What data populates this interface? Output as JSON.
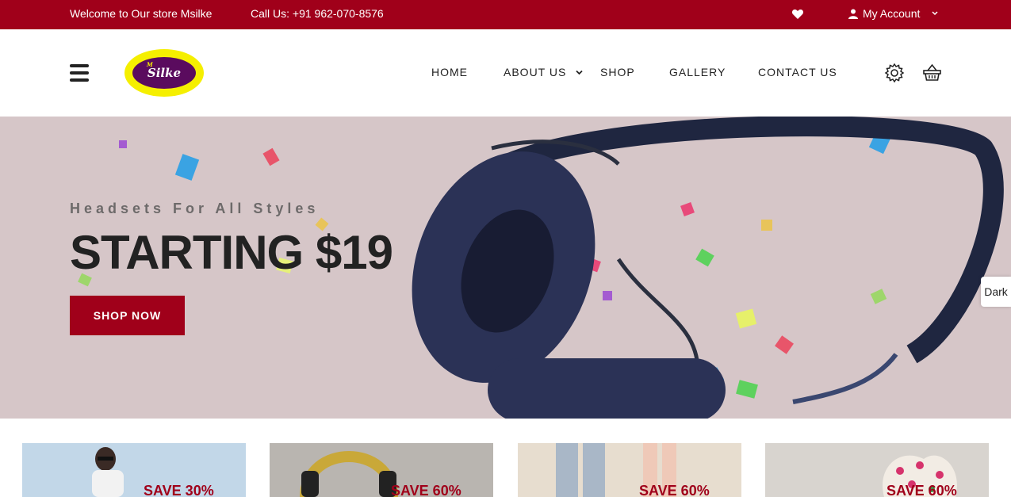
{
  "topbar": {
    "welcome": "Welcome to Our store Msilke",
    "phone": "Call Us: +91 962-070-8576",
    "account": "My Account"
  },
  "header": {
    "logo_small": "M",
    "logo_text": "Silke",
    "nav": [
      "HOME",
      "ABOUT US",
      "SHOP",
      "GALLERY",
      "CONTACT US"
    ]
  },
  "hero": {
    "tagline": "Headsets For All Styles",
    "title": "STARTING $19",
    "button": "SHOP NOW"
  },
  "dark_toggle": "Dark",
  "promos": [
    "SAVE 30%",
    "SAVE 60%",
    "SAVE 60%",
    "SAVE 60%"
  ],
  "colors": {
    "accent": "#a0001a",
    "logo_yellow": "#f5ef00",
    "logo_purple": "#5a0b5e"
  }
}
